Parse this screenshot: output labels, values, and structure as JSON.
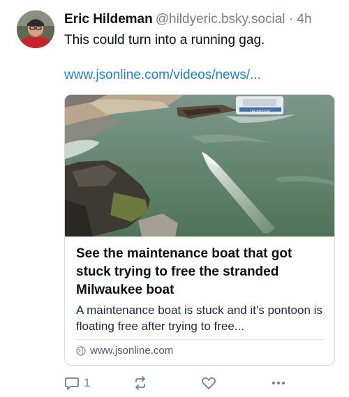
{
  "post": {
    "author_name": "Eric Hildeman",
    "author_handle": "@hildyeric.bsky.social",
    "separator": "·",
    "time": "4h",
    "text": "This could turn into a running gag.",
    "link_text": "www.jsonline.com/videos/news/...",
    "card": {
      "title": "See the maintenance boat that got stuck trying to free the stranded Milwaukee boat",
      "description": "A maintenance boat is stuck and it's pontoon is floating free after trying to free...",
      "domain": "www.jsonline.com",
      "boat_text": "THE DROUGHT"
    },
    "actions": {
      "reply_count": "1",
      "repost_count": "",
      "like_count": ""
    }
  },
  "colors": {
    "link": "#1f7ed3",
    "muted": "#6f7f8f",
    "water": "#5f7f63"
  }
}
